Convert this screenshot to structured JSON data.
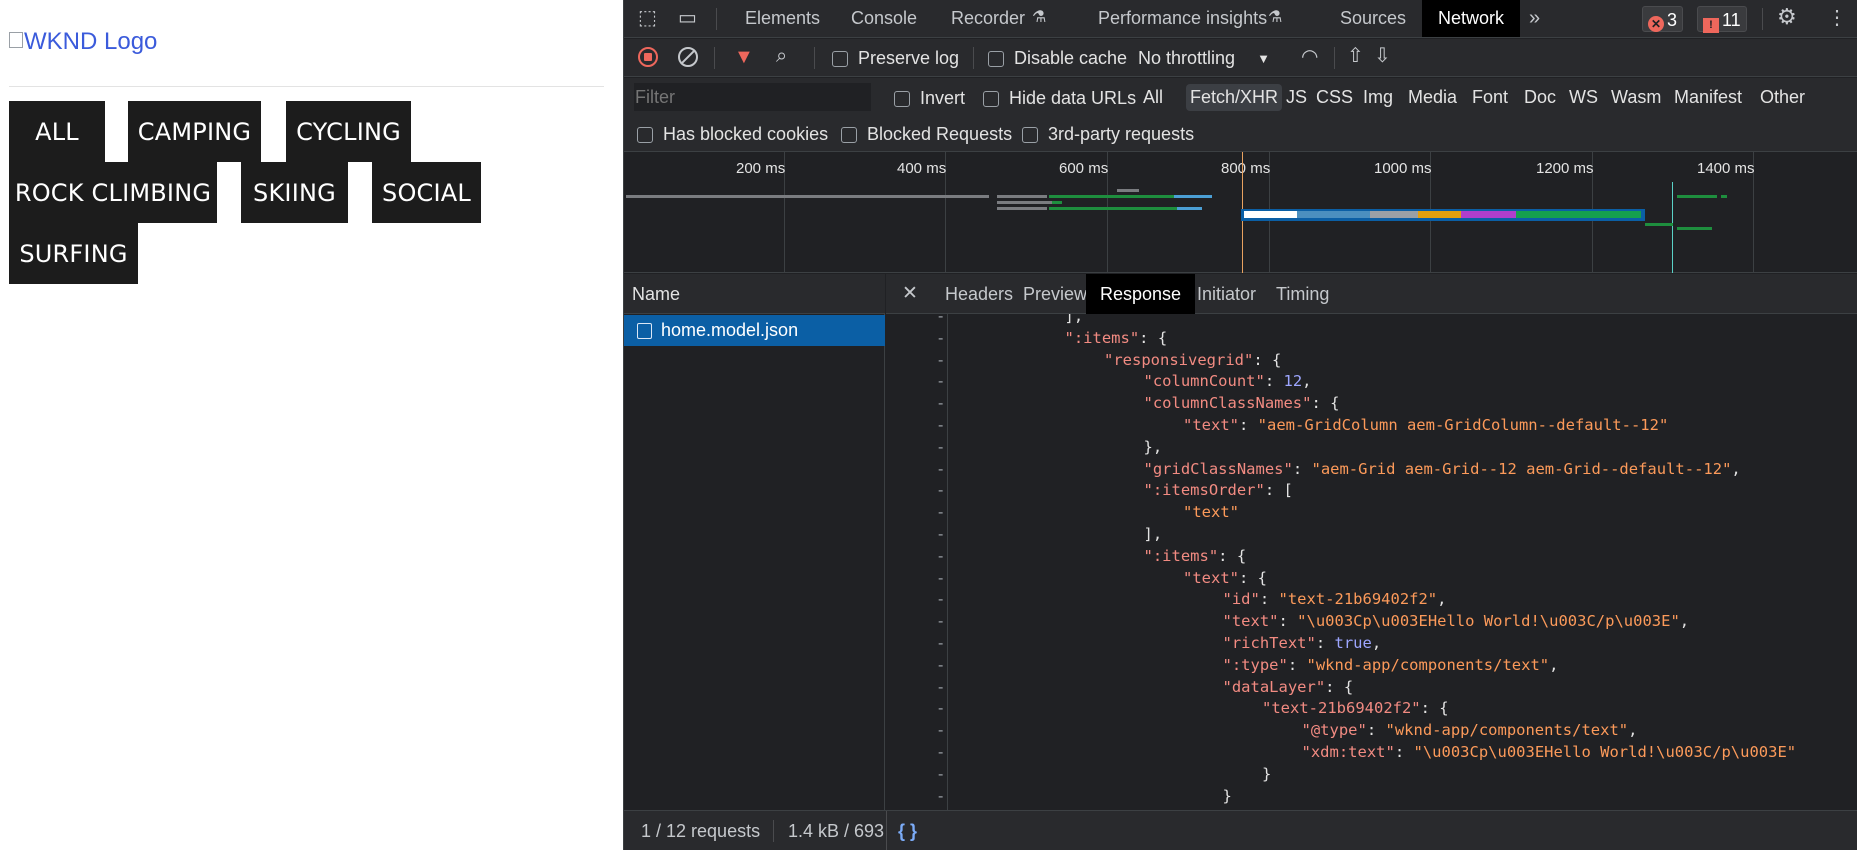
{
  "app": {
    "logo_alt": "WKND Logo",
    "tags": [
      "ALL",
      "CAMPING",
      "CYCLING",
      "ROCK CLIMBING",
      "SKIING",
      "SOCIAL",
      "SURFING"
    ]
  },
  "devtools": {
    "tabs": [
      "Elements",
      "Console",
      "Recorder",
      "Performance insights",
      "Sources",
      "Network"
    ],
    "active_tab": "Network",
    "error_count": "3",
    "issue_count": "11",
    "toolbar": {
      "preserve_log": "Preserve log",
      "disable_cache": "Disable cache",
      "throttling": "No throttling"
    },
    "filter": {
      "placeholder": "Filter",
      "invert": "Invert",
      "hide_data_urls": "Hide data URLs",
      "types": [
        "All",
        "Fetch/XHR",
        "JS",
        "CSS",
        "Img",
        "Media",
        "Font",
        "Doc",
        "WS",
        "Wasm",
        "Manifest",
        "Other"
      ],
      "active_type": "Fetch/XHR",
      "has_blocked_cookies": "Has blocked cookies",
      "blocked_requests": "Blocked Requests",
      "third_party": "3rd-party requests"
    },
    "timeline": {
      "ticks": [
        "200 ms",
        "400 ms",
        "600 ms",
        "800 ms",
        "1000 ms",
        "1200 ms",
        "1400 ms"
      ]
    },
    "requests": {
      "name_header": "Name",
      "items": [
        "home.model.json"
      ]
    },
    "detail_tabs": [
      "Headers",
      "Preview",
      "Response",
      "Initiator",
      "Timing"
    ],
    "active_detail_tab": "Response",
    "response_lines": [
      {
        "indent": 3,
        "parts": [
          [
            "p",
            "],"
          ]
        ]
      },
      {
        "indent": 3,
        "parts": [
          [
            "k",
            "\":items\""
          ],
          [
            "p",
            ": {"
          ]
        ]
      },
      {
        "indent": 4,
        "parts": [
          [
            "k",
            "\"responsivegrid\""
          ],
          [
            "p",
            ": {"
          ]
        ]
      },
      {
        "indent": 5,
        "parts": [
          [
            "k",
            "\"columnCount\""
          ],
          [
            "p",
            ": "
          ],
          [
            "n",
            "12"
          ],
          [
            "p",
            ","
          ]
        ]
      },
      {
        "indent": 5,
        "parts": [
          [
            "k",
            "\"columnClassNames\""
          ],
          [
            "p",
            ": {"
          ]
        ]
      },
      {
        "indent": 6,
        "parts": [
          [
            "k",
            "\"text\""
          ],
          [
            "p",
            ": "
          ],
          [
            "s",
            "\"aem-GridColumn aem-GridColumn--default--12\""
          ]
        ]
      },
      {
        "indent": 5,
        "parts": [
          [
            "p",
            "},"
          ]
        ]
      },
      {
        "indent": 5,
        "parts": [
          [
            "k",
            "\"gridClassNames\""
          ],
          [
            "p",
            ": "
          ],
          [
            "s",
            "\"aem-Grid aem-Grid--12 aem-Grid--default--12\""
          ],
          [
            "p",
            ","
          ]
        ]
      },
      {
        "indent": 5,
        "parts": [
          [
            "k",
            "\":itemsOrder\""
          ],
          [
            "p",
            ": ["
          ]
        ]
      },
      {
        "indent": 6,
        "parts": [
          [
            "s",
            "\"text\""
          ]
        ]
      },
      {
        "indent": 5,
        "parts": [
          [
            "p",
            "],"
          ]
        ]
      },
      {
        "indent": 5,
        "parts": [
          [
            "k",
            "\":items\""
          ],
          [
            "p",
            ": {"
          ]
        ]
      },
      {
        "indent": 6,
        "parts": [
          [
            "k",
            "\"text\""
          ],
          [
            "p",
            ": {"
          ]
        ]
      },
      {
        "indent": 7,
        "parts": [
          [
            "k",
            "\"id\""
          ],
          [
            "p",
            ": "
          ],
          [
            "s",
            "\"text-21b69402f2\""
          ],
          [
            "p",
            ","
          ]
        ]
      },
      {
        "indent": 7,
        "parts": [
          [
            "k",
            "\"text\""
          ],
          [
            "p",
            ": "
          ],
          [
            "s",
            "\"\\u003Cp\\u003EHello World!\\u003C/p\\u003E\""
          ],
          [
            "p",
            ","
          ]
        ]
      },
      {
        "indent": 7,
        "parts": [
          [
            "k",
            "\"richText\""
          ],
          [
            "p",
            ": "
          ],
          [
            "n",
            "true"
          ],
          [
            "p",
            ","
          ]
        ]
      },
      {
        "indent": 7,
        "parts": [
          [
            "k",
            "\":type\""
          ],
          [
            "p",
            ": "
          ],
          [
            "s",
            "\"wknd-app/components/text\""
          ],
          [
            "p",
            ","
          ]
        ]
      },
      {
        "indent": 7,
        "parts": [
          [
            "k",
            "\"dataLayer\""
          ],
          [
            "p",
            ": {"
          ]
        ]
      },
      {
        "indent": 8,
        "parts": [
          [
            "k",
            "\"text-21b69402f2\""
          ],
          [
            "p",
            ": {"
          ]
        ]
      },
      {
        "indent": 9,
        "parts": [
          [
            "k",
            "\"@type\""
          ],
          [
            "p",
            ": "
          ],
          [
            "s",
            "\"wknd-app/components/text\""
          ],
          [
            "p",
            ","
          ]
        ]
      },
      {
        "indent": 9,
        "parts": [
          [
            "k",
            "\"xdm:text\""
          ],
          [
            "p",
            ": "
          ],
          [
            "s",
            "\"\\u003Cp\\u003EHello World!\\u003C/p\\u003E\""
          ]
        ]
      },
      {
        "indent": 8,
        "parts": [
          [
            "p",
            "}"
          ]
        ]
      },
      {
        "indent": 7,
        "parts": [
          [
            "p",
            "}"
          ]
        ]
      },
      {
        "indent": 6,
        "parts": [
          [
            "p",
            "},"
          ]
        ]
      }
    ],
    "status": {
      "requests": "1 / 12 requests",
      "transferred": "1.4 kB / 693",
      "pretty_print": "{ }"
    },
    "colors": {
      "panel_bg": "#202124",
      "toolbar_bg": "#292a2d",
      "selection": "#0b5fa5",
      "record_red": "#ee675c",
      "json_key": "#f28b82",
      "json_string": "#fc9a5a",
      "json_number": "#9da6ff"
    }
  }
}
